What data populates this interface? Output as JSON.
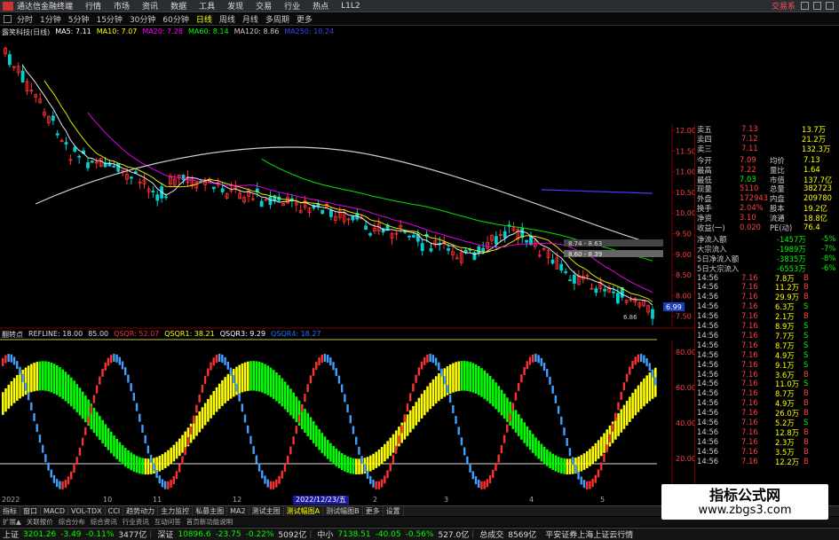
{
  "titlebar": {
    "app_name": "通达信金融终端",
    "menus": [
      "行情",
      "市场",
      "资讯",
      "数据",
      "工具",
      "发现",
      "交易",
      "行业",
      "热点",
      "L1L2"
    ],
    "trade_link": "交易系"
  },
  "periodbar": {
    "periods": [
      "分时",
      "1分钟",
      "5分钟",
      "15分钟",
      "30分钟",
      "60分钟",
      "日线",
      "周线",
      "月线",
      "多周期",
      "更多"
    ],
    "active": "日线"
  },
  "main_chart": {
    "stock_name": "露笑科技(日线)",
    "ma_legend": [
      {
        "label": "MA5: 7.11",
        "color": "#ffffff"
      },
      {
        "label": "MA10: 7.07",
        "color": "#ffff00"
      },
      {
        "label": "MA20: 7.28",
        "color": "#ff00ff"
      },
      {
        "label": "MA60: 8.14",
        "color": "#00ff00"
      },
      {
        "label": "MA120: 8.86",
        "color": "#cccccc"
      },
      {
        "label": "MA250: 10.24",
        "color": "#4040ff"
      }
    ],
    "price_ticks": [
      "12.00",
      "11.50",
      "11.00",
      "10.50",
      "10.00",
      "9.50",
      "9.00",
      "8.50",
      "8.00",
      "7.50"
    ],
    "annotations": {
      "label_a": "8.74 - 8.63",
      "label_b": "8.60 - 8.39",
      "low_label": "6.86",
      "current_price": "6.99"
    }
  },
  "indicator": {
    "name": "翻转点",
    "refline": "REFLINE: 18.00",
    "level": "85.00",
    "params": [
      {
        "label": "QSQR: 52.07",
        "color": "#ff3030"
      },
      {
        "label": "QSQR1: 38.21",
        "color": "#ffff00"
      },
      {
        "label": "QSQR3: 9.29",
        "color": "#ffffff"
      },
      {
        "label": "QSQR4: 18.27",
        "color": "#2070ff"
      }
    ],
    "ticks": [
      "80.00",
      "60.00",
      "40.00",
      "20.00"
    ],
    "date_label": "2022/12/23/五",
    "axis_left": "2022",
    "axis_months": [
      "10",
      "11",
      "12",
      "2",
      "3",
      "4",
      "5"
    ]
  },
  "right_panel": {
    "sell_rows": [
      {
        "label": "卖五",
        "price": "7.13",
        "vol": "13.7万"
      },
      {
        "label": "卖四",
        "price": "7.12",
        "vol": "21.2万"
      },
      {
        "label": "卖三",
        "price": "7.11",
        "vol": "132.3万"
      }
    ],
    "stats": [
      {
        "l1": "今开",
        "v1": "7.09",
        "l2": "均价",
        "v2": "7.13"
      },
      {
        "l1": "最高",
        "v1": "7.22",
        "l2": "量比",
        "v2": "1.64"
      },
      {
        "l1": "最低",
        "v1": "7.03",
        "l2": "市值",
        "v2": "137.7亿"
      },
      {
        "l1": "现量",
        "v1": "5110",
        "l2": "总量",
        "v2": "382723"
      },
      {
        "l1": "外盘",
        "v1": "172943",
        "l2": "内盘",
        "v2": "209780"
      },
      {
        "l1": "换手",
        "v1": "2.04%",
        "l2": "股本",
        "v2": "19.2亿"
      },
      {
        "l1": "净资",
        "v1": "3.10",
        "l2": "流通",
        "v2": "18.8亿"
      },
      {
        "l1": "收益(一)",
        "v1": "0.020",
        "l2": "PE(动)",
        "v2": "76.4"
      }
    ],
    "flows": [
      {
        "label": "净流入额",
        "value": "-1457万",
        "pct": "-5%"
      },
      {
        "label": "大宗流入",
        "value": "-1989万",
        "pct": "-7%"
      },
      {
        "label": "5日净流入额",
        "value": "-3835万",
        "pct": "-8%"
      },
      {
        "label": "5日大宗流入",
        "value": "-6553万",
        "pct": "-6%"
      }
    ],
    "ticks": [
      {
        "time": "14:56",
        "price": "7.16",
        "vol": "7.8万",
        "side": "B"
      },
      {
        "time": "14:56",
        "price": "7.16",
        "vol": "11.2万",
        "side": "B"
      },
      {
        "time": "14:56",
        "price": "7.16",
        "vol": "29.9万",
        "side": "B"
      },
      {
        "time": "14:56",
        "price": "7.16",
        "vol": "6.3万",
        "side": "S"
      },
      {
        "time": "14:56",
        "price": "7.16",
        "vol": "2.1万",
        "side": "B"
      },
      {
        "time": "14:56",
        "price": "7.16",
        "vol": "8.9万",
        "side": "S"
      },
      {
        "time": "14:56",
        "price": "7.16",
        "vol": "7.7万",
        "side": "S"
      },
      {
        "time": "14:56",
        "price": "7.16",
        "vol": "8.7万",
        "side": "S"
      },
      {
        "time": "14:56",
        "price": "7.16",
        "vol": "4.9万",
        "side": "S"
      },
      {
        "time": "14:56",
        "price": "7.16",
        "vol": "9.1万",
        "side": "S"
      },
      {
        "time": "14:56",
        "price": "7.16",
        "vol": "3.6万",
        "side": "B"
      },
      {
        "time": "14:56",
        "price": "7.16",
        "vol": "11.0万",
        "side": "S"
      },
      {
        "time": "14:56",
        "price": "7.16",
        "vol": "8.7万",
        "side": "B"
      },
      {
        "time": "14:56",
        "price": "7.16",
        "vol": "4.9万",
        "side": "B"
      },
      {
        "time": "14:56",
        "price": "7.16",
        "vol": "26.0万",
        "side": "B"
      },
      {
        "time": "14:56",
        "price": "7.16",
        "vol": "5.2万",
        "side": "S"
      },
      {
        "time": "14:56",
        "price": "7.16",
        "vol": "12.8万",
        "side": "B"
      },
      {
        "time": "14:56",
        "price": "7.16",
        "vol": "2.3万",
        "side": "B"
      },
      {
        "time": "14:56",
        "price": "7.16",
        "vol": "3.5万",
        "side": "B"
      },
      {
        "time": "14:56",
        "price": "7.16",
        "vol": "12.2万",
        "side": "B"
      }
    ]
  },
  "tabs": [
    "指标",
    "窗口",
    "MACD",
    "VOL-TDX",
    "CCI",
    "趋势动力",
    "主力监控",
    "私募主图",
    "MA2",
    "测试主图",
    "测试幅图A",
    "测试幅图B",
    "更多",
    "设置"
  ],
  "active_tab": "测试幅图A",
  "subtabs": [
    "扩展▲",
    "关联报价",
    "综合分布",
    "综合资讯",
    "行业资讯",
    "互动问答",
    "首页新功能说明"
  ],
  "indexbar": [
    {
      "name": "上证",
      "value": "3201.26",
      "change": "-3.49",
      "pct": "-0.11%",
      "amount": "3477亿"
    },
    {
      "name": "深证",
      "value": "10896.6",
      "change": "-23.75",
      "pct": "-0.22%",
      "amount": "5092亿"
    },
    {
      "name": "中小",
      "value": "7138.51",
      "change": "-40.05",
      "pct": "-0.56%",
      "amount": "527.0亿"
    }
  ],
  "total": {
    "label": "总成交",
    "value": "8569亿"
  },
  "broker": "平安证券上海上证云行情",
  "watermark": {
    "title": "指标公式网",
    "url": "www.zbgs3.com"
  },
  "colors": {
    "up": "#ff3030",
    "down": "#00d0d0",
    "green": "#00ff00",
    "yellow": "#ffff00",
    "magenta": "#ff00ff"
  }
}
